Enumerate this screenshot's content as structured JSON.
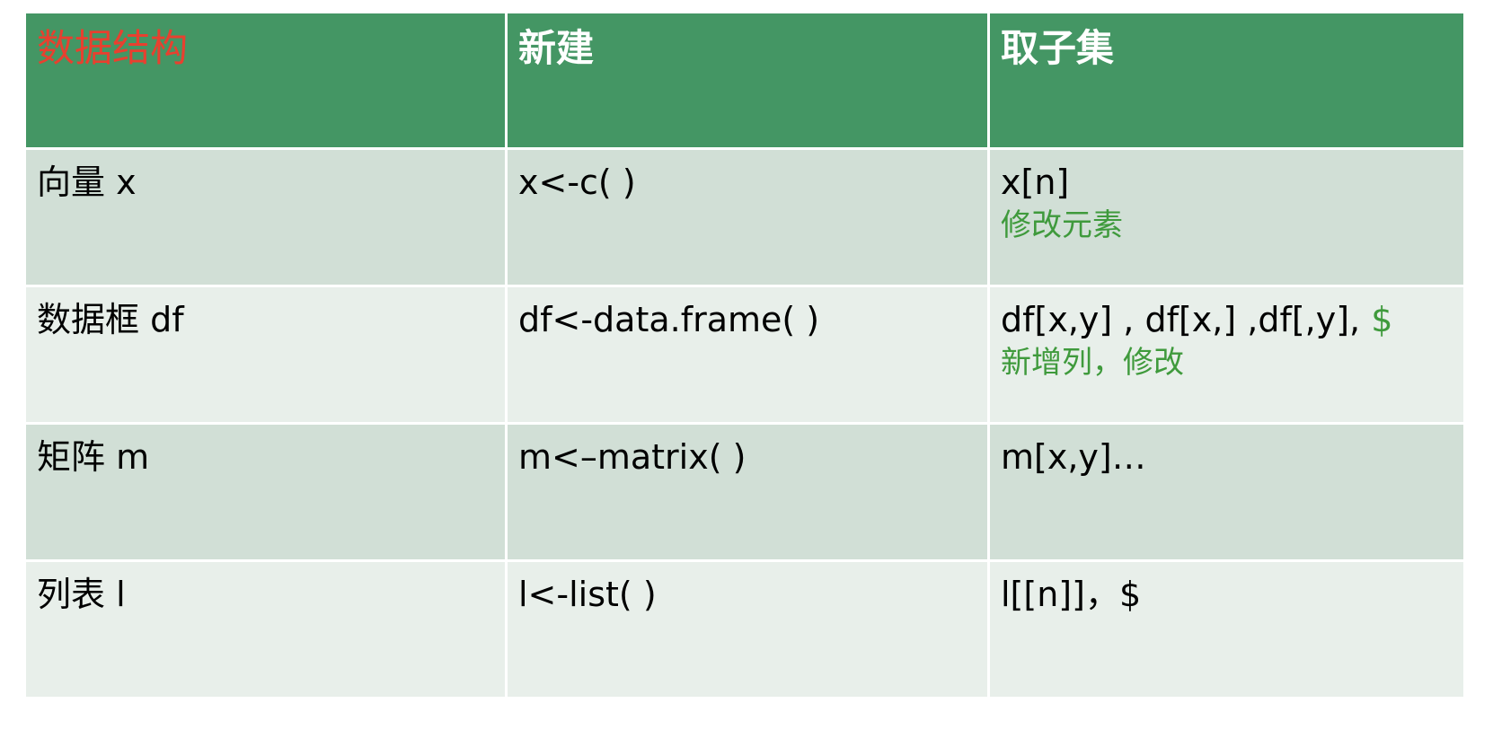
{
  "colors": {
    "header_bg": "#449664",
    "header_text": "#ffffff",
    "first_header_text": "#e8402f",
    "row_odd_bg": "#d1dfd6",
    "row_even_bg": "#e8efea",
    "note_text": "#3f9a3c"
  },
  "table": {
    "headers": [
      "数据结构",
      "新建",
      "取子集"
    ],
    "rows": [
      {
        "structure": "向量 x",
        "create": "x<-c( )",
        "subset": "x[n]",
        "subset_accent": "",
        "note": "修改元素"
      },
      {
        "structure": "数据框 df",
        "create": "df<-data.frame( )",
        "subset": "df[x,y] , df[x,] ,df[,y], ",
        "subset_accent": "$",
        "note": "新增列，修改"
      },
      {
        "structure": "矩阵 m",
        "create": "m<–matrix( )",
        "subset": "m[x,y]…",
        "subset_accent": "",
        "note": ""
      },
      {
        "structure": "列表 l",
        "create": "l<-list( )",
        "subset": "l[[n]]，$",
        "subset_accent": "",
        "note": ""
      }
    ]
  }
}
